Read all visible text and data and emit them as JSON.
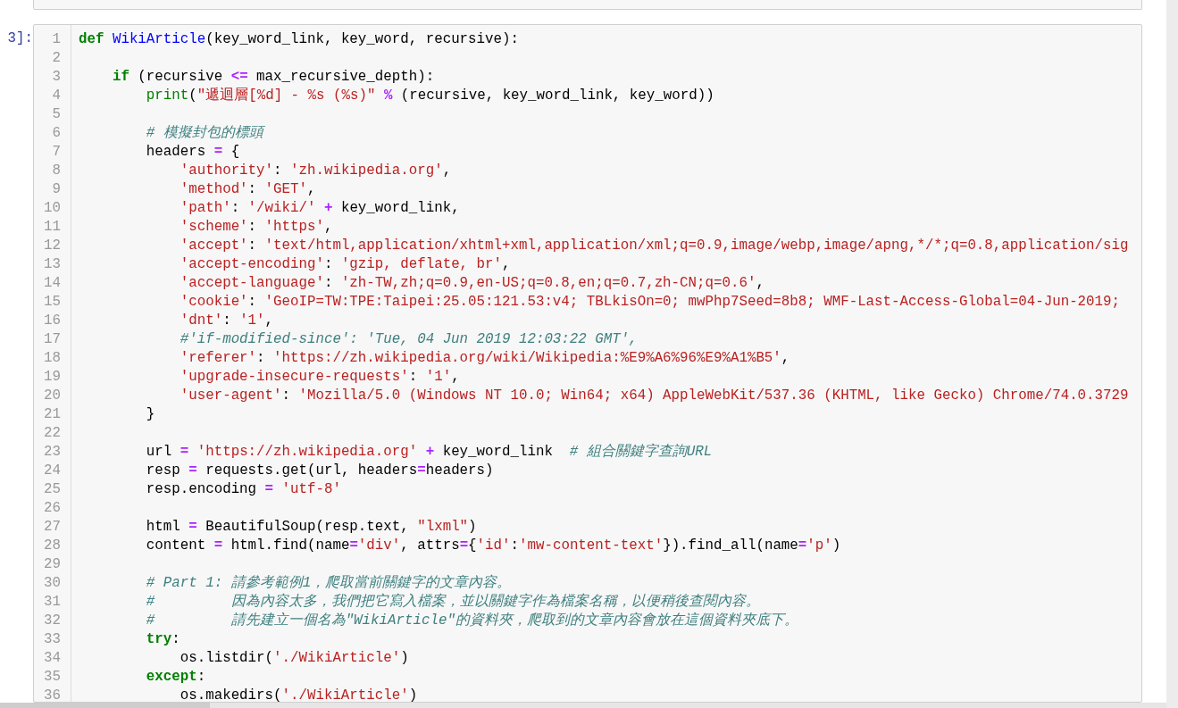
{
  "cell": {
    "prompt": "3]:",
    "lines": [
      {
        "number": "1",
        "tokens": [
          {
            "kind": "kw",
            "text": "def"
          },
          {
            "kind": "fn",
            "text": " WikiArticle"
          },
          {
            "kind": "t",
            "text": "(key_word_link, key_word, recursive):"
          }
        ]
      },
      {
        "number": "2"
      },
      {
        "number": "3",
        "tokens": [
          {
            "kind": "kw",
            "text": "    if"
          },
          {
            "kind": "t",
            "text": " (recursive "
          },
          {
            "kind": "op",
            "text": "<="
          },
          {
            "kind": "t",
            "text": " max_recursive_depth):"
          }
        ]
      },
      {
        "number": "4",
        "tokens": [
          {
            "kind": "bi",
            "text": "        print"
          },
          {
            "kind": "t",
            "text": "("
          },
          {
            "kind": "str",
            "text": "\"遞迴層[%d] - %s (%s)\""
          },
          {
            "kind": "op",
            "text": " %"
          },
          {
            "kind": "t",
            "text": " (recursive, key_word_link, key_word))"
          }
        ]
      },
      {
        "number": "5"
      },
      {
        "number": "6",
        "tokens": [
          {
            "kind": "cm",
            "text": "        # 模擬封包的標頭"
          }
        ]
      },
      {
        "number": "7",
        "tokens": [
          {
            "kind": "t",
            "text": "        headers "
          },
          {
            "kind": "op",
            "text": "="
          },
          {
            "kind": "t",
            "text": " {"
          }
        ]
      },
      {
        "number": "8",
        "tokens": [
          {
            "kind": "str",
            "text": "            'authority'"
          },
          {
            "kind": "t",
            "text": ": "
          },
          {
            "kind": "str",
            "text": "'zh.wikipedia.org'"
          },
          {
            "kind": "t",
            "text": ","
          }
        ]
      },
      {
        "number": "9",
        "tokens": [
          {
            "kind": "str",
            "text": "            'method'"
          },
          {
            "kind": "t",
            "text": ": "
          },
          {
            "kind": "str",
            "text": "'GET'"
          },
          {
            "kind": "t",
            "text": ","
          }
        ]
      },
      {
        "number": "10",
        "tokens": [
          {
            "kind": "str",
            "text": "            'path'"
          },
          {
            "kind": "t",
            "text": ": "
          },
          {
            "kind": "str",
            "text": "'/wiki/'"
          },
          {
            "kind": "op",
            "text": " +"
          },
          {
            "kind": "t",
            "text": " key_word_link,"
          }
        ]
      },
      {
        "number": "11",
        "tokens": [
          {
            "kind": "str",
            "text": "            'scheme'"
          },
          {
            "kind": "t",
            "text": ": "
          },
          {
            "kind": "str",
            "text": "'https'"
          },
          {
            "kind": "t",
            "text": ","
          }
        ]
      },
      {
        "number": "12",
        "tokens": [
          {
            "kind": "str",
            "text": "            'accept'"
          },
          {
            "kind": "t",
            "text": ": "
          },
          {
            "kind": "str",
            "text": "'text/html,application/xhtml+xml,application/xml;q=0.9,image/webp,image/apng,*/*;q=0.8,application/sig"
          }
        ]
      },
      {
        "number": "13",
        "tokens": [
          {
            "kind": "str",
            "text": "            'accept-encoding'"
          },
          {
            "kind": "t",
            "text": ": "
          },
          {
            "kind": "str",
            "text": "'gzip, deflate, br'"
          },
          {
            "kind": "t",
            "text": ","
          }
        ]
      },
      {
        "number": "14",
        "tokens": [
          {
            "kind": "str",
            "text": "            'accept-language'"
          },
          {
            "kind": "t",
            "text": ": "
          },
          {
            "kind": "str",
            "text": "'zh-TW,zh;q=0.9,en-US;q=0.8,en;q=0.7,zh-CN;q=0.6'"
          },
          {
            "kind": "t",
            "text": ","
          }
        ]
      },
      {
        "number": "15",
        "tokens": [
          {
            "kind": "str",
            "text": "            'cookie'"
          },
          {
            "kind": "t",
            "text": ": "
          },
          {
            "kind": "str",
            "text": "'GeoIP=TW:TPE:Taipei:25.05:121.53:v4; TBLkisOn=0; mwPhp7Seed=8b8; WMF-Last-Access-Global=04-Jun-2019;"
          }
        ]
      },
      {
        "number": "16",
        "tokens": [
          {
            "kind": "str",
            "text": "            'dnt'"
          },
          {
            "kind": "t",
            "text": ": "
          },
          {
            "kind": "str",
            "text": "'1'"
          },
          {
            "kind": "t",
            "text": ","
          }
        ]
      },
      {
        "number": "17",
        "tokens": [
          {
            "kind": "cm",
            "text": "            #'if-modified-since': 'Tue, 04 Jun 2019 12:03:22 GMT',"
          }
        ]
      },
      {
        "number": "18",
        "tokens": [
          {
            "kind": "str",
            "text": "            'referer'"
          },
          {
            "kind": "t",
            "text": ": "
          },
          {
            "kind": "str",
            "text": "'https://zh.wikipedia.org/wiki/Wikipedia:%E9%A6%96%E9%A1%B5'"
          },
          {
            "kind": "t",
            "text": ","
          }
        ]
      },
      {
        "number": "19",
        "tokens": [
          {
            "kind": "str",
            "text": "            'upgrade-insecure-requests'"
          },
          {
            "kind": "t",
            "text": ": "
          },
          {
            "kind": "str",
            "text": "'1'"
          },
          {
            "kind": "t",
            "text": ","
          }
        ]
      },
      {
        "number": "20",
        "tokens": [
          {
            "kind": "str",
            "text": "            'user-agent'"
          },
          {
            "kind": "t",
            "text": ": "
          },
          {
            "kind": "str",
            "text": "'Mozilla/5.0 (Windows NT 10.0; Win64; x64) AppleWebKit/537.36 (KHTML, like Gecko) Chrome/74.0.3729"
          }
        ]
      },
      {
        "number": "21",
        "tokens": [
          {
            "kind": "t",
            "text": "        }"
          }
        ]
      },
      {
        "number": "22"
      },
      {
        "number": "23",
        "tokens": [
          {
            "kind": "t",
            "text": "        url "
          },
          {
            "kind": "op",
            "text": "="
          },
          {
            "kind": "str",
            "text": " 'https://zh.wikipedia.org'"
          },
          {
            "kind": "op",
            "text": " +"
          },
          {
            "kind": "t",
            "text": " key_word_link  "
          },
          {
            "kind": "cm",
            "text": "# 組合關鍵字查詢URL"
          }
        ]
      },
      {
        "number": "24",
        "tokens": [
          {
            "kind": "t",
            "text": "        resp "
          },
          {
            "kind": "op",
            "text": "="
          },
          {
            "kind": "t",
            "text": " requests.get(url, headers"
          },
          {
            "kind": "op",
            "text": "="
          },
          {
            "kind": "t",
            "text": "headers)"
          }
        ]
      },
      {
        "number": "25",
        "tokens": [
          {
            "kind": "t",
            "text": "        resp.encoding "
          },
          {
            "kind": "op",
            "text": "="
          },
          {
            "kind": "str",
            "text": " 'utf-8'"
          }
        ]
      },
      {
        "number": "26"
      },
      {
        "number": "27",
        "tokens": [
          {
            "kind": "t",
            "text": "        html "
          },
          {
            "kind": "op",
            "text": "="
          },
          {
            "kind": "t",
            "text": " BeautifulSoup(resp.text, "
          },
          {
            "kind": "str",
            "text": "\"lxml\""
          },
          {
            "kind": "t",
            "text": ")"
          }
        ]
      },
      {
        "number": "28",
        "tokens": [
          {
            "kind": "t",
            "text": "        content "
          },
          {
            "kind": "op",
            "text": "="
          },
          {
            "kind": "t",
            "text": " html.find(name"
          },
          {
            "kind": "op",
            "text": "="
          },
          {
            "kind": "str",
            "text": "'div'"
          },
          {
            "kind": "t",
            "text": ", attrs"
          },
          {
            "kind": "op",
            "text": "="
          },
          {
            "kind": "t",
            "text": "{"
          },
          {
            "kind": "str",
            "text": "'id'"
          },
          {
            "kind": "t",
            "text": ":"
          },
          {
            "kind": "str",
            "text": "'mw-content-text'"
          },
          {
            "kind": "t",
            "text": "}).find_all(name"
          },
          {
            "kind": "op",
            "text": "="
          },
          {
            "kind": "str",
            "text": "'p'"
          },
          {
            "kind": "t",
            "text": ")"
          }
        ]
      },
      {
        "number": "29"
      },
      {
        "number": "30",
        "tokens": [
          {
            "kind": "cm",
            "text": "        # Part 1: 請參考範例1，爬取當前關鍵字的文章內容。"
          }
        ]
      },
      {
        "number": "31",
        "tokens": [
          {
            "kind": "cm",
            "text": "        #         因為內容太多，我們把它寫入檔案，並以關鍵字作為檔案名稱，以便稍後查閱內容。"
          }
        ]
      },
      {
        "number": "32",
        "tokens": [
          {
            "kind": "cm",
            "text": "        #         請先建立一個名為\"WikiArticle\"的資料夾，爬取到的文章內容會放在這個資料夾底下。"
          }
        ]
      },
      {
        "number": "33",
        "tokens": [
          {
            "kind": "kw",
            "text": "        try"
          },
          {
            "kind": "t",
            "text": ":"
          }
        ]
      },
      {
        "number": "34",
        "tokens": [
          {
            "kind": "t",
            "text": "            os.listdir("
          },
          {
            "kind": "str",
            "text": "'./WikiArticle'"
          },
          {
            "kind": "t",
            "text": ")"
          }
        ]
      },
      {
        "number": "35",
        "tokens": [
          {
            "kind": "kw",
            "text": "        except"
          },
          {
            "kind": "t",
            "text": ":"
          }
        ]
      },
      {
        "number": "36",
        "tokens": [
          {
            "kind": "t",
            "text": "            os.makedirs("
          },
          {
            "kind": "str",
            "text": "'./WikiArticle'"
          },
          {
            "kind": "t",
            "text": ")"
          }
        ]
      }
    ]
  }
}
